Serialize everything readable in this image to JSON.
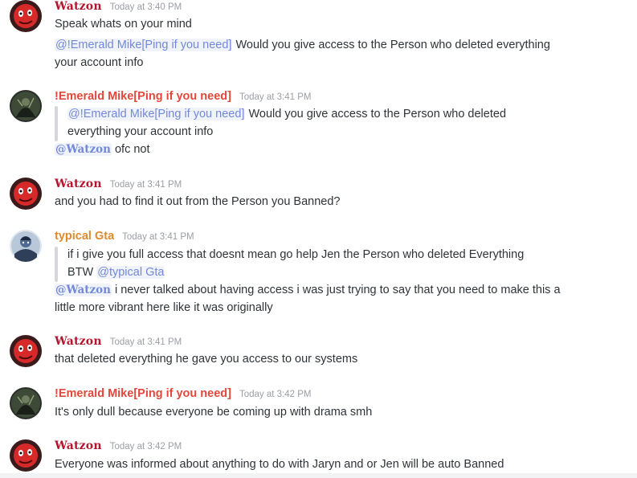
{
  "colors": {
    "watzon": "#b5162e",
    "emerald": "#e0483b",
    "typical": "#e08a2c",
    "mention_text": "#7289da",
    "timestamp": "#9a9ea4",
    "body_text": "#2e3338"
  },
  "icons": {
    "watzon_avatar": "red-mask-avatar-icon",
    "emerald_avatar": "dark-figure-avatar-icon",
    "typical_avatar": "blue-character-avatar-icon"
  },
  "messages": [
    {
      "author": "Watzon",
      "time": "Today at 3:40 PM",
      "line1": "Speak whats on your mind",
      "mention": "@!Emerald Mike[Ping if you need]",
      "line2_rest": " Would you give access to the Person who deleted everything",
      "line3": "your account info"
    },
    {
      "author": "!Emerald Mike[Ping if you need]",
      "time": "Today at 3:41 PM",
      "quote_mention": "@!Emerald Mike[Ping if you need]",
      "quote_rest": " Would you give access to the Person who deleted",
      "quote_line2": "everything your account info",
      "reply_mention": "@Watzon",
      "reply_rest": " ofc not"
    },
    {
      "author": "Watzon",
      "time": "Today at 3:41 PM",
      "line1": "and you had to find it out from the Person you Banned?"
    },
    {
      "author": "typical Gta",
      "time": "Today at 3:41 PM",
      "quote_line1": "if i give you full access that doesnt mean go help Jen the Person who deleted Everything",
      "quote_line2_prefix": "BTW ",
      "quote_mention": "@typical Gta",
      "reply_mention": "@Watzon",
      "reply_rest": " i never talked about having access i was just trying to say that you need to make this a",
      "reply_line2": "little more vibrant here like it was originally"
    },
    {
      "author": "Watzon",
      "time": "Today at 3:41 PM",
      "line1": "that deleted everything he gave you access to our systems"
    },
    {
      "author": "!Emerald Mike[Ping if you need]",
      "time": "Today at 3:42 PM",
      "line1": "It's only dull because everyone be coming up with drama smh"
    },
    {
      "author": "Watzon",
      "time": "Today at 3:42 PM",
      "line1": "Everyone was informed about anything to do with Jaryn and or Jen will be auto Banned"
    }
  ]
}
